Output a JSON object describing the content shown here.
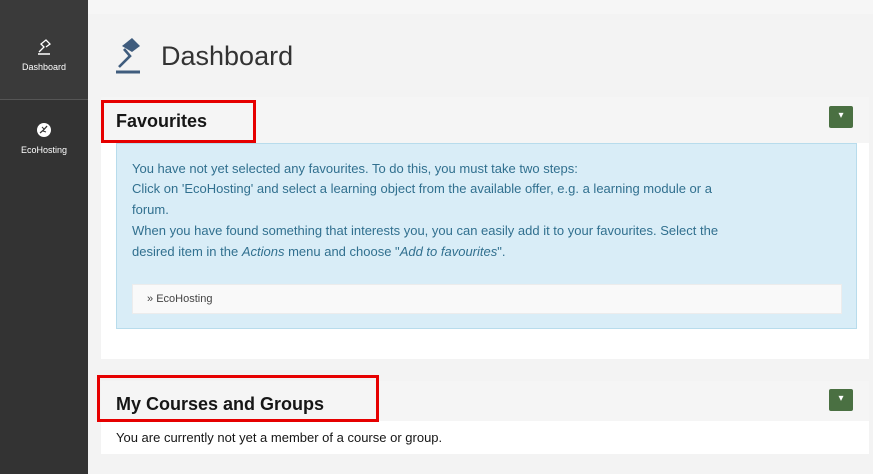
{
  "sidebar": {
    "items": [
      {
        "label": "Dashboard",
        "icon": "dashboard-lamp-icon"
      },
      {
        "label": "EcoHosting",
        "icon": "leaf-icon"
      }
    ]
  },
  "header": {
    "title": "Dashboard",
    "icon": "dashboard-lamp-icon"
  },
  "favourites": {
    "title": "Favourites",
    "toggle_label": "▾",
    "info_lines": [
      "You have not yet selected any favourites. To do this, you must take two steps:",
      "Click on 'EcoHosting' and select a learning object from the available offer, e.g. a learning module or a",
      "forum.",
      "When you have found something that interests you, you can easily add it to your favourites. Select the"
    ],
    "line5": {
      "a": "desired item in the ",
      "b": "Actions",
      "c": " menu and choose \"",
      "d": "Add to favourites",
      "e": "\"."
    },
    "link_prefix": "» ",
    "link_text": "EcoHosting"
  },
  "courses": {
    "title": "My Courses and Groups",
    "toggle_label": "▾",
    "message": "You are currently not yet a member of a course or group."
  },
  "colors": {
    "sidebar": "#333333",
    "info_bg": "#d9edf7",
    "info_text": "#31708f",
    "toggle": "#4a7042",
    "highlight": "#e60000"
  }
}
